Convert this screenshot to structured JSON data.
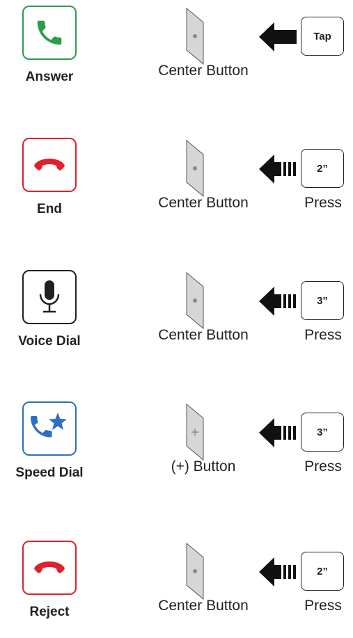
{
  "rows": [
    {
      "function": "Answer",
      "icon": "phone-answer-icon",
      "button": "Center Button",
      "action": "Tap",
      "press": ""
    },
    {
      "function": "End",
      "icon": "phone-hangup-icon",
      "button": "Center Button",
      "action": "2”",
      "press": "Press"
    },
    {
      "function": "Voice Dial",
      "icon": "microphone-icon",
      "button": "Center Button",
      "action": "3”",
      "press": "Press"
    },
    {
      "function": "Speed Dial",
      "icon": "phone-star-icon",
      "button": "(+) Button",
      "action": "3”",
      "press": "Press"
    },
    {
      "function": "Reject",
      "icon": "phone-hangup-icon",
      "button": "Center Button",
      "action": "2”",
      "press": "Press"
    }
  ],
  "colors": {
    "answer": "#2a9d46",
    "end": "#e0202a",
    "voice": "#231f20",
    "speed": "#2f6fc0",
    "reject": "#e0202a"
  }
}
